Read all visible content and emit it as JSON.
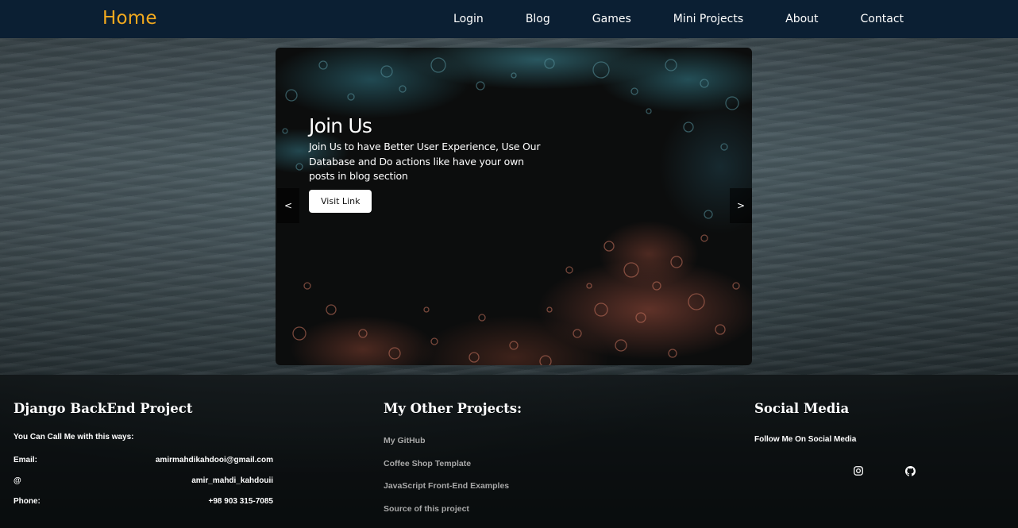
{
  "navbar": {
    "brand": "Home",
    "links": [
      "Login",
      "Blog",
      "Games",
      "Mini Projects",
      "About",
      "Contact"
    ]
  },
  "carousel": {
    "title": "Join Us",
    "description": "Join Us to have Better User Experience, Use Our Database and Do actions like have your own posts in blog section",
    "button_label": "Visit Link",
    "prev_label": "<",
    "next_label": ">"
  },
  "footer": {
    "col1": {
      "title": "Django BackEnd Project",
      "subtitle": "You Can Call Me with this ways:",
      "rows": [
        {
          "label": "Email:",
          "value": "amirmahdikahdooi@gmail.com"
        },
        {
          "label": "@",
          "value": "amir_mahdi_kahdouii"
        },
        {
          "label": "Phone:",
          "value": "+98 903 315-7085"
        }
      ]
    },
    "col2": {
      "title": "My Other Projects:",
      "links": [
        "My GitHub",
        "Coffee Shop Template",
        "JavaScript Front-End Examples",
        "Source of this project"
      ]
    },
    "col3": {
      "title": "Social Media",
      "subtitle": "Follow Me On Social Media",
      "icons": [
        "instagram-icon",
        "github-icon"
      ]
    }
  },
  "colors": {
    "navbar_bg": "#0b1f33",
    "brand": "#f2a91e",
    "footer_link": "#a8a8a8"
  }
}
